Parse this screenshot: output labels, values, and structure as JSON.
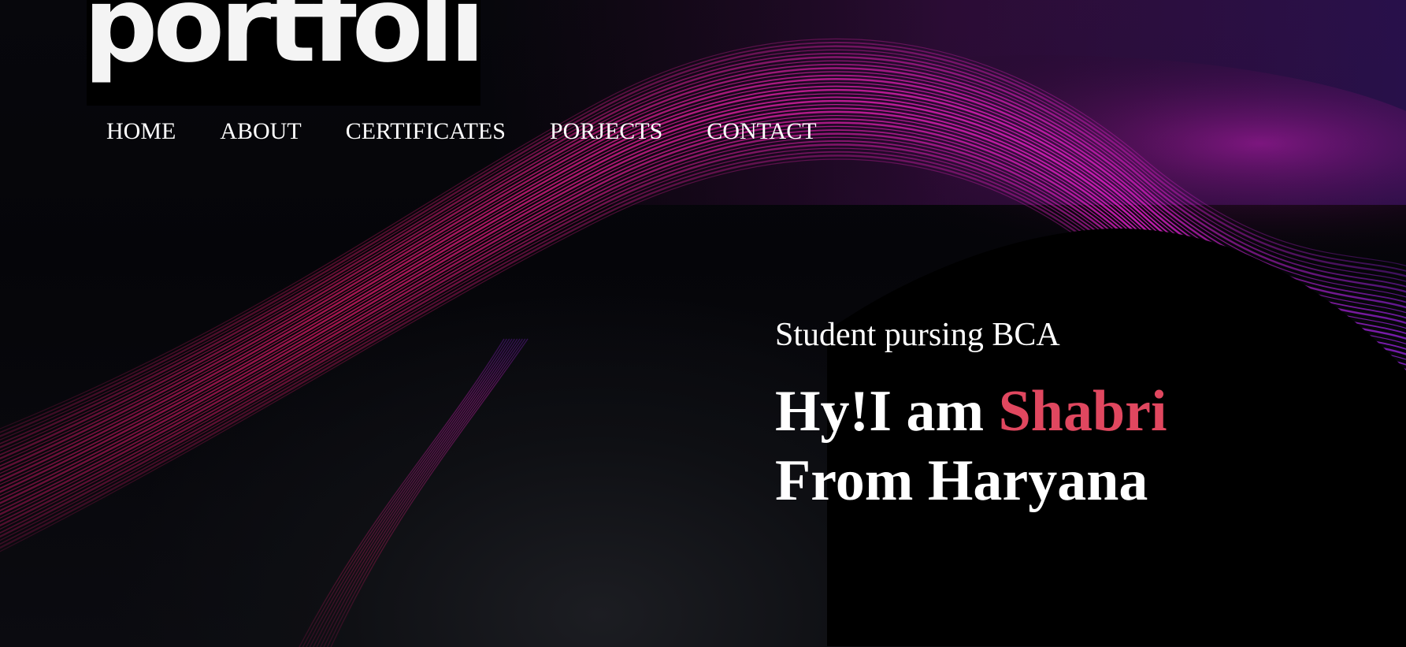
{
  "logo": {
    "text": "portfolio"
  },
  "nav": {
    "items": [
      {
        "label": "HOME"
      },
      {
        "label": "ABOUT"
      },
      {
        "label": "CERTIFICATES"
      },
      {
        "label": "PORJECTS"
      },
      {
        "label": "CONTACT"
      }
    ]
  },
  "hero": {
    "subtitle": "Student pursing BCA",
    "greeting": "Hy!I am ",
    "name": "Shabri",
    "origin": "From Haryana"
  },
  "colors": {
    "name_accent": "#e0475f",
    "wave_magenta": "#e020c8",
    "wave_crimson": "#c0185a",
    "wave_violet": "#7a1fc8",
    "background": "#050509"
  }
}
